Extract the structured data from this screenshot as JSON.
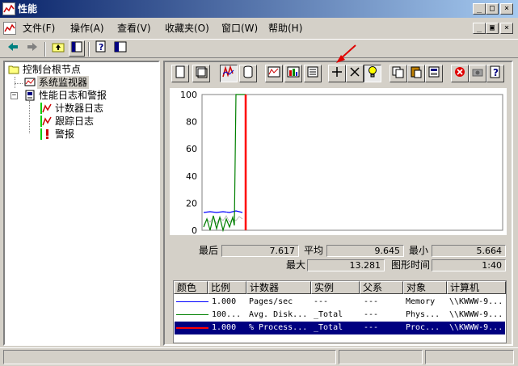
{
  "window": {
    "title": "性能",
    "btn_min": "_",
    "btn_max": "□",
    "btn_close": "×"
  },
  "menu": {
    "items": [
      "文件(F)",
      "操作(A)",
      "查看(V)",
      "收藏夹(O)",
      "窗口(W)",
      "帮助(H)"
    ],
    "child_btn_min": "_",
    "child_btn_restore": "▣",
    "child_btn_close": "×"
  },
  "toolbar": {
    "icons": [
      "back-arrow-icon",
      "forward-arrow-icon",
      "up-folder-icon",
      "show-tree-icon",
      "help-icon",
      "mmc-icon"
    ]
  },
  "tree": {
    "root": "控制台根节点",
    "sysmon": "系统监视器",
    "perflogs": "性能日志和警报",
    "counter_logs": "计数器日志",
    "trace_logs": "跟踪日志",
    "alerts": "警报",
    "expander": "−"
  },
  "graph": {
    "y_ticks": [
      "100",
      "80",
      "60",
      "40",
      "20",
      "0"
    ],
    "series_colors": {
      "memory": "#0000ff",
      "disk": "#008000",
      "processor": "#ffffff",
      "timebar": "#ff0000"
    }
  },
  "stats": {
    "last_label": "最后",
    "last_value": "7.617",
    "avg_label": "平均",
    "avg_value": "9.645",
    "min_label": "最小",
    "min_value": "5.664",
    "max_label": "最大",
    "max_value": "13.281",
    "duration_label": "图形时间",
    "duration_value": "1:40"
  },
  "legend": {
    "headers": [
      "颜色",
      "比例",
      "计数器",
      "实例",
      "父系",
      "对象",
      "计算机"
    ],
    "rows": [
      {
        "color": "#0000ff",
        "scale": "1.000",
        "counter": "Pages/sec",
        "instance": "---",
        "parent": "---",
        "object": "Memory",
        "computer": "\\\\KWWW-9...",
        "selected": false
      },
      {
        "color": "#008000",
        "scale": "100...",
        "counter": "Avg. Disk...",
        "instance": "_Total",
        "parent": "---",
        "object": "Phys...",
        "computer": "\\\\KWWW-9...",
        "selected": false
      },
      {
        "color": "#ff0000",
        "scale": "1.000",
        "counter": "% Process...",
        "instance": "_Total",
        "parent": "---",
        "object": "Proc...",
        "computer": "\\\\KWWW-9...",
        "selected": true
      }
    ]
  }
}
